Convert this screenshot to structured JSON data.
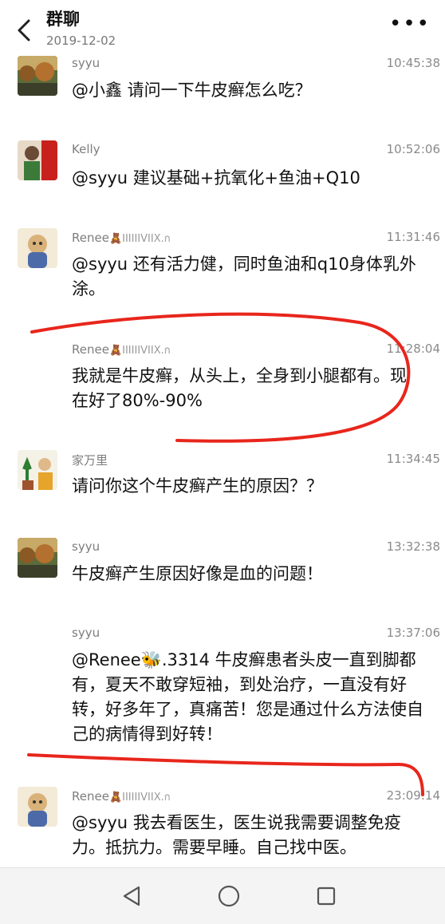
{
  "header": {
    "title": "群聊",
    "date": "2019-12-02",
    "more": "•••"
  },
  "messages": [
    {
      "sender": "syyu",
      "time": "10:45:38",
      "text": "@小鑫 请问一下牛皮癣怎么吃？",
      "avatar": "landscape-avatar"
    },
    {
      "sender": "Kelly",
      "time": "10:52:06",
      "text": "@syyu 建议基础+抗氧化+鱼油+Q10",
      "avatar": "photo-avatar"
    },
    {
      "sender": "Renee",
      "sender_suffix": "🧸IIIIIIVIIX.ก",
      "time": "11:31:46",
      "text": "@syyu 还有活力健，同时鱼油和q10身体乳外涂。",
      "avatar": "cartoon-avatar"
    },
    {
      "sender": "Renee",
      "sender_suffix": "🧸IIIIIIVIIX.ก",
      "time": "11:28:04",
      "text": "我就是牛皮癣，从头上，全身到小腿都有。现在好了80%-90%",
      "avatar": ""
    },
    {
      "sender": "家万里",
      "time": "11:34:45",
      "text": "请问你这个牛皮癣产生的原因？？",
      "avatar": "plant-avatar"
    },
    {
      "sender": "syyu",
      "time": "13:32:38",
      "text": "牛皮癣产生原因好像是血的问题！",
      "avatar": "landscape-avatar"
    },
    {
      "sender": "syyu",
      "time": "13:37:06",
      "text": "@Renee🐝.3314 牛皮癣患者头皮一直到脚都有，夏天不敢穿短袖，到处治疗，一直没有好转，好多年了，真痛苦！您是通过什么方法使自己的病情得到好转！",
      "avatar": ""
    },
    {
      "sender": "Renee",
      "sender_suffix": "🧸IIIIIIVIIX.ก",
      "time": "23:09:14",
      "text": "@syyu 我去看医生，医生说我需要调整免疫力。抵抗力。需要早睡。自己找中医。",
      "avatar": "cartoon-avatar"
    }
  ],
  "colors": {
    "annotation_red": "#e8261c",
    "nav_bg": "#f4f4f4"
  }
}
